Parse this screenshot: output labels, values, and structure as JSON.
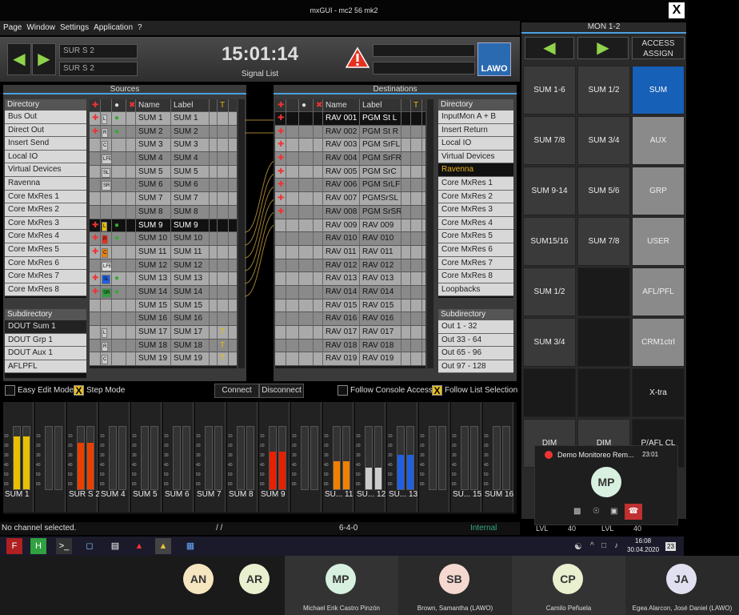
{
  "window": {
    "title": "mxGUI - mc2 56 mk2",
    "close": "X"
  },
  "menu": [
    "Page",
    "Window",
    "Settings",
    "Application",
    "?"
  ],
  "toolbar": {
    "sur1": "SUR S  2",
    "sur2": "SUR S  2",
    "clock": "15:01:14",
    "signal_list": "Signal List",
    "logo": "LAWO"
  },
  "sources": {
    "title": "Sources",
    "directory_header": "Directory",
    "directory": [
      "Bus Out",
      "Direct Out",
      "Insert Send",
      "Local IO",
      "Virtual Devices",
      "Ravenna",
      "Core MxRes 1",
      "Core MxRes 2",
      "Core MxRes 3",
      "Core MxRes 4",
      "Core MxRes 5",
      "Core MxRes 6",
      "Core MxRes 7",
      "Core MxRes 8"
    ],
    "subdirectory_header": "Subdirectory",
    "subdirectory": [
      "DOUT Sum 1",
      "DOUT Grp 1",
      "DOUT Aux 1",
      "AFLPFL"
    ],
    "columns": {
      "name": "Name",
      "label": "Label",
      "t": "T"
    },
    "rows": [
      {
        "badge": "L",
        "name": "SUM   1",
        "label": "SUM   1"
      },
      {
        "badge": "R",
        "name": "SUM   2",
        "label": "SUM   2"
      },
      {
        "badge": "C",
        "name": "SUM   3",
        "label": "SUM   3"
      },
      {
        "badge": "LFE",
        "name": "SUM   4",
        "label": "SUM   4"
      },
      {
        "badge": "SL",
        "name": "SUM   5",
        "label": "SUM   5"
      },
      {
        "badge": "SR",
        "name": "SUM   6",
        "label": "SUM   6"
      },
      {
        "badge": "",
        "name": "SUM   7",
        "label": "SUM   7"
      },
      {
        "badge": "",
        "name": "SUM   8",
        "label": "SUM   8"
      },
      {
        "badge": "L",
        "name": "SUM   9",
        "label": "SUM   9"
      },
      {
        "badge": "R",
        "name": "SUM  10",
        "label": "SUM  10"
      },
      {
        "badge": "C",
        "name": "SUM  11",
        "label": "SUM  11"
      },
      {
        "badge": "LFE",
        "name": "SUM  12",
        "label": "SUM  12"
      },
      {
        "badge": "SL",
        "name": "SUM  13",
        "label": "SUM  13"
      },
      {
        "badge": "SR",
        "name": "SUM  14",
        "label": "SUM  14"
      },
      {
        "badge": "",
        "name": "SUM  15",
        "label": "SUM  15"
      },
      {
        "badge": "",
        "name": "SUM  16",
        "label": "SUM  16"
      },
      {
        "badge": "L",
        "name": "SUM  17",
        "label": "SUM  17"
      },
      {
        "badge": "R",
        "name": "SUM  18",
        "label": "SUM  18"
      },
      {
        "badge": "C",
        "name": "SUM  19",
        "label": "SUM  19"
      }
    ]
  },
  "destinations": {
    "title": "Destinations",
    "directory_header": "Directory",
    "directory": [
      "InputMon A + B",
      "Insert Return",
      "Local IO",
      "Virtual Devices",
      "Ravenna",
      "Core MxRes 1",
      "Core MxRes 2",
      "Core MxRes 3",
      "Core MxRes 4",
      "Core MxRes 5",
      "Core MxRes 6",
      "Core MxRes 7",
      "Core MxRes 8",
      "Loopbacks"
    ],
    "subdirectory_header": "Subdirectory",
    "subdirectory": [
      "Out 1 - 32",
      "Out 33 - 64",
      "Out 65 - 96",
      "Out 97 - 128"
    ],
    "columns": {
      "name": "Name",
      "label": "Label",
      "t": "T"
    },
    "rows": [
      {
        "name": "RAV 001",
        "label": "PGM St L"
      },
      {
        "name": "RAV 002",
        "label": "PGM St R"
      },
      {
        "name": "RAV 003",
        "label": "PGM SrFL"
      },
      {
        "name": "RAV 004",
        "label": "PGM SrFR"
      },
      {
        "name": "RAV 005",
        "label": "PGM SrC"
      },
      {
        "name": "RAV 006",
        "label": "PGM SrLF"
      },
      {
        "name": "RAV 007",
        "label": "PGMSrSL"
      },
      {
        "name": "RAV 008",
        "label": "PGM SrSR"
      },
      {
        "name": "RAV 009",
        "label": "RAV 009"
      },
      {
        "name": "RAV 010",
        "label": "RAV 010"
      },
      {
        "name": "RAV 011",
        "label": "RAV 011"
      },
      {
        "name": "RAV 012",
        "label": "RAV 012"
      },
      {
        "name": "RAV 013",
        "label": "RAV 013"
      },
      {
        "name": "RAV 014",
        "label": "RAV 014"
      },
      {
        "name": "RAV 015",
        "label": "RAV 015"
      },
      {
        "name": "RAV 016",
        "label": "RAV 016"
      },
      {
        "name": "RAV 017",
        "label": "RAV 017"
      },
      {
        "name": "RAV 018",
        "label": "RAV 018"
      },
      {
        "name": "RAV 019",
        "label": "RAV 019"
      }
    ]
  },
  "options": {
    "easy_edit": "Easy Edit Mode",
    "step_mode": "Step Mode",
    "connect": "Connect",
    "disconnect": "Disconnect",
    "follow_console": "Follow Console Access",
    "follow_list": "Follow List Selection",
    "check_mark": "X"
  },
  "meters": [
    {
      "label": "SUM    1",
      "fill": 0.85,
      "color": "#e8c000"
    },
    {
      "label": "",
      "fill": 0.0,
      "color": "#e8c000"
    },
    {
      "label": "SUR S  2",
      "fill": 0.75,
      "color": "#e84000"
    },
    {
      "label": "SUM    4",
      "fill": 0.0,
      "color": "#e8c000"
    },
    {
      "label": "SUM    5",
      "fill": 0.0,
      "color": "#e8c000"
    },
    {
      "label": "SUM    6",
      "fill": 0.0,
      "color": "#e8c000"
    },
    {
      "label": "SUM    7",
      "fill": 0.0,
      "color": "#e8c000"
    },
    {
      "label": "SUM    8",
      "fill": 0.0,
      "color": "#e8c000"
    },
    {
      "label": "SUM    9",
      "fill": 0.6,
      "color": "#e82000"
    },
    {
      "label": "",
      "fill": 0.0,
      "color": "#e8c000"
    },
    {
      "label": "SU...  11",
      "fill": 0.45,
      "color": "#f08000"
    },
    {
      "label": "SU...  12",
      "fill": 0.35,
      "color": "#cccccc"
    },
    {
      "label": "SU...  13",
      "fill": 0.55,
      "color": "#2060e0"
    },
    {
      "label": "",
      "fill": 0.0,
      "color": "#e8c000"
    },
    {
      "label": "SU...  15",
      "fill": 0.0,
      "color": "#e8c000"
    },
    {
      "label": "SUM  16",
      "fill": 0.0,
      "color": "#e8c000"
    }
  ],
  "meter_scale": [
    "10",
    "20",
    "30",
    "40",
    "50",
    "60"
  ],
  "status": {
    "message": "No channel selected.",
    "slash": "/ /",
    "center": "6-4-0",
    "internal": "Internal"
  },
  "mon": {
    "title": "MON 1-2",
    "access_assign": "ACCESS ASSIGN",
    "col1": [
      "SUM 1-6",
      "SUM 7/8",
      "SUM 9-14",
      "SUM15/16",
      "SUM 1/2",
      "SUM 3/4",
      "",
      "DIM"
    ],
    "col2": [
      "SUM 1/2",
      "SUM 3/4",
      "SUM 5/6",
      "SUM 7/8",
      "",
      "",
      "",
      "DIM"
    ],
    "col3": [
      "SUM",
      "AUX",
      "GRP",
      "USER",
      "AFL/PFL",
      "CRM1ctrl",
      "X-tra",
      "P/AFL CL"
    ],
    "lvl": [
      "LVL",
      "40",
      "LVL",
      "40"
    ]
  },
  "popup": {
    "title": "Demo Monitoreo Rem...",
    "time": "23:01",
    "initials": "MP"
  },
  "taskbar": {
    "time": "16:08",
    "date": "30.04.2020",
    "badge": "23"
  },
  "participants": [
    {
      "initials": "AN",
      "name": "",
      "color": "#f5e6c0"
    },
    {
      "initials": "AR",
      "name": "",
      "color": "#e8f0d0"
    },
    {
      "initials": "MP",
      "name": "Michael Erik Castro Pinzón",
      "color": "#d8f0e0"
    },
    {
      "initials": "SB",
      "name": "Brown, Samantha (LAWO)",
      "color": "#f5d8d0"
    },
    {
      "initials": "CP",
      "name": "Camilo Peñuela",
      "color": "#e8f0d0"
    },
    {
      "initials": "JA",
      "name": "Egea Alarcon, José Daniel (LAWO)",
      "color": "#e0e0f0"
    }
  ]
}
